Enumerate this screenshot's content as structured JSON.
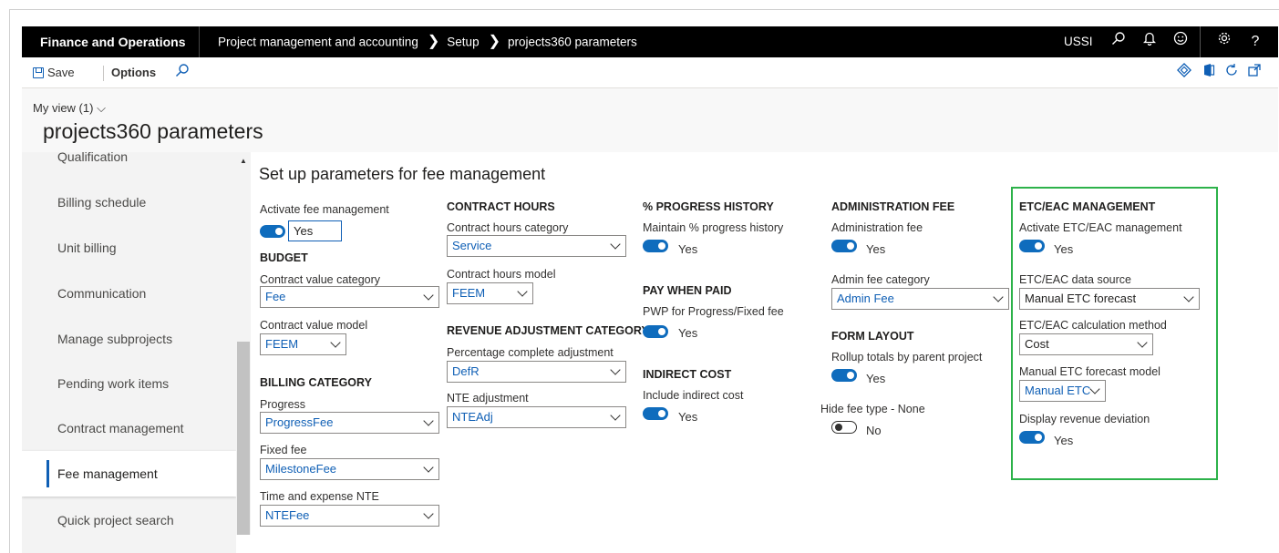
{
  "topbar": {
    "brand": "Finance and Operations",
    "breadcrumbs": [
      "Project management and accounting",
      "Setup",
      "projects360 parameters"
    ],
    "company": "USSI",
    "icons": [
      "search-icon",
      "bell-icon",
      "smiley-icon",
      "gear-icon",
      "help-icon"
    ]
  },
  "actionbar": {
    "save_label": "Save",
    "options_label": "Options",
    "right_icons": [
      "diamond-icon",
      "office-icon",
      "refresh-icon",
      "popout-icon"
    ]
  },
  "header": {
    "myview": "My view (1)",
    "title": "projects360 parameters"
  },
  "leftnav": {
    "items": [
      {
        "label": "Qualification"
      },
      {
        "label": "Billing schedule"
      },
      {
        "label": "Unit billing"
      },
      {
        "label": "Communication"
      },
      {
        "label": "Manage subprojects"
      },
      {
        "label": "Pending work items"
      },
      {
        "label": "Contract management"
      },
      {
        "label": "Fee management"
      },
      {
        "label": "Quick project search"
      }
    ],
    "active": "Fee management"
  },
  "content": {
    "section_title": "Set up parameters for fee management",
    "col1": {
      "activate_fee_label": "Activate fee management",
      "activate_fee_value": "Yes",
      "budget_heading": "BUDGET",
      "contract_value_category_label": "Contract value category",
      "contract_value_category_value": "Fee",
      "contract_value_model_label": "Contract value model",
      "contract_value_model_value": "FEEM",
      "billing_category_heading": "BILLING CATEGORY",
      "progress_label": "Progress",
      "progress_value": "ProgressFee",
      "fixed_fee_label": "Fixed fee",
      "fixed_fee_value": "MilestoneFee",
      "tande_nte_label": "Time and expense NTE",
      "tande_nte_value": "NTEFee"
    },
    "col2": {
      "contract_hours_heading": "CONTRACT HOURS",
      "contract_hours_category_label": "Contract hours category",
      "contract_hours_category_value": "Service",
      "contract_hours_model_label": "Contract hours model",
      "contract_hours_model_value": "FEEM",
      "rev_adj_heading": "REVENUE ADJUSTMENT CATEGORY",
      "pct_complete_adj_label": "Percentage complete adjustment",
      "pct_complete_adj_value": "DefR",
      "nte_adj_label": "NTE adjustment",
      "nte_adj_value": "NTEAdj"
    },
    "col3": {
      "progress_history_heading": "% PROGRESS HISTORY",
      "maintain_progress_label": "Maintain % progress history",
      "maintain_progress_value": "Yes",
      "pay_when_paid_heading": "PAY WHEN PAID",
      "pwp_label": "PWP for Progress/Fixed fee",
      "pwp_value": "Yes",
      "indirect_cost_heading": "INDIRECT COST",
      "include_indirect_label": "Include indirect cost",
      "include_indirect_value": "Yes"
    },
    "col4": {
      "admin_fee_heading": "ADMINISTRATION FEE",
      "admin_fee_label": "Administration fee",
      "admin_fee_value": "Yes",
      "admin_fee_category_label": "Admin fee category",
      "admin_fee_category_value": "Admin Fee",
      "form_layout_heading": "FORM LAYOUT",
      "rollup_label": "Rollup totals by parent project",
      "rollup_value": "Yes",
      "hide_fee_label": "Hide fee type - None",
      "hide_fee_value": "No"
    },
    "col5": {
      "etc_heading": "ETC/EAC MANAGEMENT",
      "activate_etc_label": "Activate ETC/EAC management",
      "activate_etc_value": "Yes",
      "data_source_label": "ETC/EAC data source",
      "data_source_value": "Manual ETC forecast",
      "calc_method_label": "ETC/EAC calculation method",
      "calc_method_value": "Cost",
      "forecast_model_label": "Manual ETC forecast model",
      "forecast_model_value": "Manual ETC",
      "revenue_dev_label": "Display revenue deviation",
      "revenue_dev_value": "Yes"
    }
  },
  "colors": {
    "accent": "#0f6cbd",
    "highlight_border": "#2db24a",
    "topbar": "#000000"
  }
}
